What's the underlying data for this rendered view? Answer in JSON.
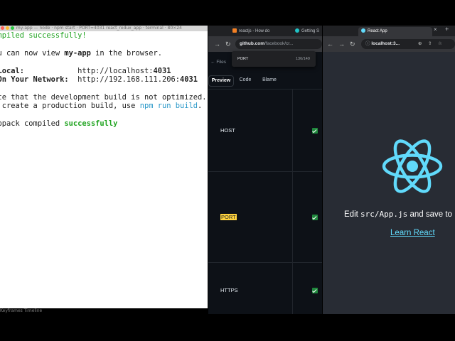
{
  "terminal": {
    "titlebar_text": "my-app — node · npm start · PORT=4031 react_redux_app · terminal · 80×24",
    "lines": [
      [
        {
          "t": "Compiled successfully!",
          "c": "g"
        }
      ],
      [
        {
          "t": ""
        }
      ],
      [
        {
          "t": "You can now view "
        },
        {
          "t": "my-app",
          "c": "b"
        },
        {
          "t": " in the browser."
        }
      ],
      [
        {
          "t": ""
        }
      ],
      [
        {
          "t": "  Local:",
          "c": "b"
        },
        {
          "t": "            http://localhost:"
        },
        {
          "t": "4031",
          "c": "b"
        }
      ],
      [
        {
          "t": "  On Your Network:",
          "c": "b"
        },
        {
          "t": "  http://192.168.111.206:"
        },
        {
          "t": "4031",
          "c": "b"
        }
      ],
      [
        {
          "t": ""
        }
      ],
      [
        {
          "t": "Note that the development build is not optimized."
        }
      ],
      [
        {
          "t": "To create a production build, use "
        },
        {
          "t": "npm run build",
          "c": "cy"
        },
        {
          "t": "."
        }
      ],
      [
        {
          "t": ""
        }
      ],
      [
        {
          "t": "webpack compiled "
        },
        {
          "t": "successfully",
          "c": "gb"
        }
      ]
    ],
    "footer_text": "Keyframes      Timeline"
  },
  "github": {
    "tabs": [
      {
        "label": "reactjs - How do"
      },
      {
        "label": "Getting S"
      }
    ],
    "address_host": "github.com",
    "address_rest": "/facebook/cr...",
    "find_query": "PORT",
    "find_count": "136/149",
    "files_label": "Files",
    "view_tabs": [
      "Preview",
      "Code",
      "Blame"
    ],
    "rows": [
      {
        "key": "HOST",
        "highlight": false
      },
      {
        "key": "PORT",
        "highlight": true
      },
      {
        "key": "HTTPS",
        "highlight": false
      }
    ]
  },
  "react": {
    "tab_label": "React App",
    "address": "localhost:3...",
    "edit_prefix": "Edit ",
    "edit_code": "src/App.js",
    "edit_suffix": " and save to",
    "link_label": "Learn React",
    "logo_color": "#61dafb"
  }
}
